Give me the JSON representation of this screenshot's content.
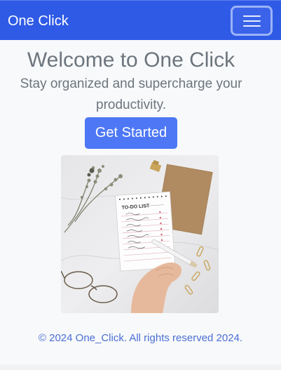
{
  "navbar": {
    "brand": "One Click",
    "menu_icon": "hamburger-menu-icon",
    "bg_color": "#2f5ae6"
  },
  "hero": {
    "title": "Welcome to One Click",
    "subtitle": "Stay organized and supercharge your productivity.",
    "cta_label": "Get Started",
    "cta_color": "#4d77f5",
    "image_list_heading": "TO-DO LIST",
    "image_list_items": [
      "a",
      "b",
      "c",
      "d",
      "e",
      "f",
      "g",
      "h"
    ]
  },
  "footer": {
    "text": "© 2024 One_Click. All rights reserved 2024."
  }
}
